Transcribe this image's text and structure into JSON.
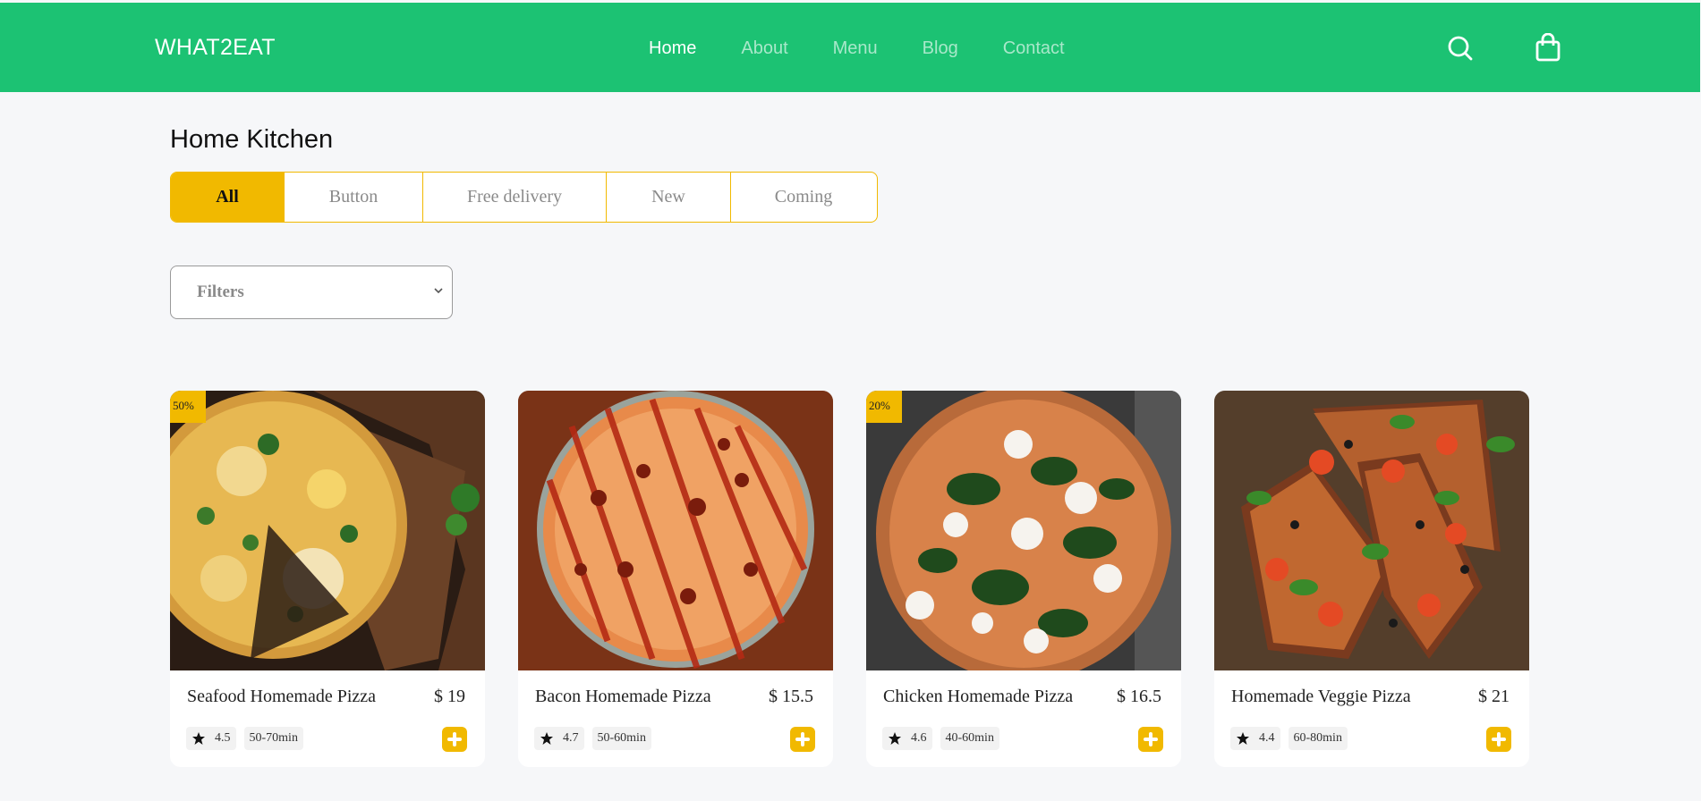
{
  "header": {
    "brand": "WHAT2EAT",
    "nav": [
      {
        "label": "Home",
        "active": true
      },
      {
        "label": "About",
        "active": false
      },
      {
        "label": "Menu",
        "active": false
      },
      {
        "label": "Blog",
        "active": false
      },
      {
        "label": "Contact",
        "active": false
      }
    ],
    "icons": [
      "search-icon",
      "shopping-bag-icon"
    ]
  },
  "section": {
    "title": "Home Kitchen",
    "tabs": [
      {
        "label": "All",
        "active": true
      },
      {
        "label": "Button",
        "active": false
      },
      {
        "label": "Free delivery",
        "active": false
      },
      {
        "label": "New",
        "active": false
      },
      {
        "label": "Coming",
        "active": false
      }
    ],
    "filter": {
      "selected": "Filters"
    }
  },
  "products": [
    {
      "name": "Seafood Homemade Pizza",
      "price": "$ 19",
      "rating": "4.5",
      "time": "50-70min",
      "badge": "50%"
    },
    {
      "name": "Bacon Homemade Pizza",
      "price": "$ 15.5",
      "rating": "4.7",
      "time": "50-60min",
      "badge": ""
    },
    {
      "name": "Chicken Homemade Pizza",
      "price": "$ 16.5",
      "rating": "4.6",
      "time": "40-60min",
      "badge": "20%"
    },
    {
      "name": "Homemade Veggie Pizza",
      "price": "$ 21",
      "rating": "4.4",
      "time": "60-80min",
      "badge": ""
    }
  ],
  "colors": {
    "primary": "#1cc273",
    "accent": "#f1b900",
    "background": "#f6f7f9"
  }
}
